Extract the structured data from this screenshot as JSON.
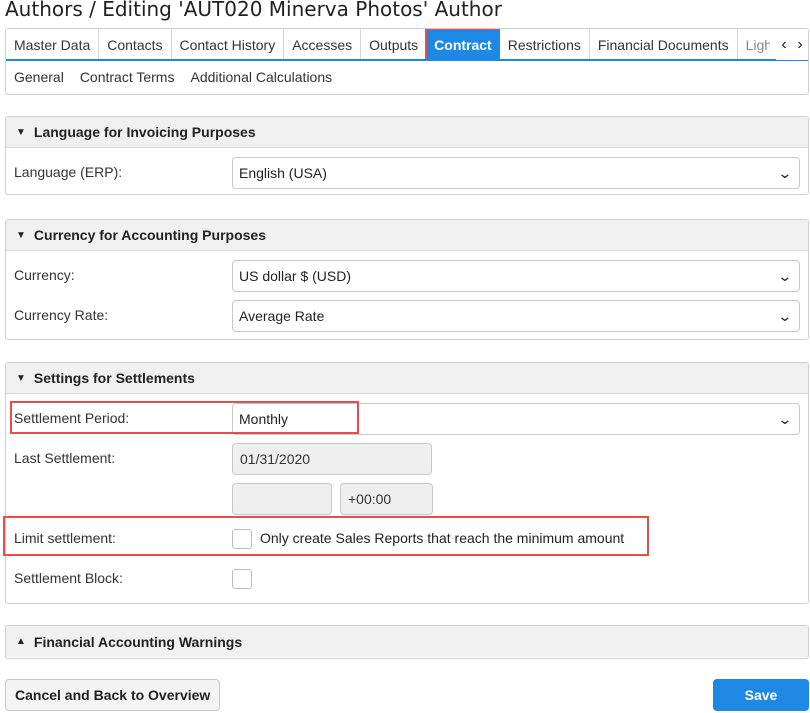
{
  "page": {
    "title": "Authors / Editing 'AUT020 Minerva Photos' Author"
  },
  "tabs": [
    {
      "label": "Master Data"
    },
    {
      "label": "Contacts"
    },
    {
      "label": "Contact History"
    },
    {
      "label": "Accesses"
    },
    {
      "label": "Outputs"
    },
    {
      "label": "Contract",
      "active": true
    },
    {
      "label": "Restrictions"
    },
    {
      "label": "Financial Documents"
    },
    {
      "label": "Ligh"
    }
  ],
  "tab_nav": {
    "prev_icon": "chevron-left-icon",
    "next_icon": "chevron-right-icon",
    "prev": "‹",
    "next": "›"
  },
  "subtabs": [
    {
      "label": "General"
    },
    {
      "label": "Contract Terms"
    },
    {
      "label": "Additional Calculations"
    }
  ],
  "sections": {
    "language": {
      "title": "Language for Invoicing Purposes",
      "fields": {
        "language_erp": {
          "label": "Language (ERP):",
          "value": "English (USA)"
        }
      }
    },
    "currency": {
      "title": "Currency for Accounting Purposes",
      "fields": {
        "currency": {
          "label": "Currency:",
          "value": "US dollar $ (USD)"
        },
        "currency_rate": {
          "label": "Currency Rate:",
          "value": "Average Rate"
        }
      }
    },
    "settlements": {
      "title": "Settings for Settlements",
      "fields": {
        "settlement_period": {
          "label": "Settlement Period:",
          "value": "Monthly"
        },
        "last_settlement": {
          "label": "Last Settlement:",
          "value": "01/31/2020"
        },
        "time": {
          "value": ""
        },
        "timezone": {
          "value": "+00:00"
        },
        "limit_settlement": {
          "label": "Limit settlement:",
          "checkbox_label": "Only create Sales Reports that reach the minimum amount",
          "checked": false
        },
        "settlement_block": {
          "label": "Settlement Block:",
          "checked": false
        }
      }
    },
    "warnings": {
      "title": "Financial Accounting Warnings",
      "collapsed": true
    }
  },
  "buttons": {
    "cancel": "Cancel and Back to Overview",
    "save": "Save"
  },
  "icons": {
    "expanded": "▼",
    "collapsed": "▲",
    "dropdown": "⌄"
  },
  "colors": {
    "accent": "#1e88e5",
    "highlight": "#e84c4c"
  }
}
